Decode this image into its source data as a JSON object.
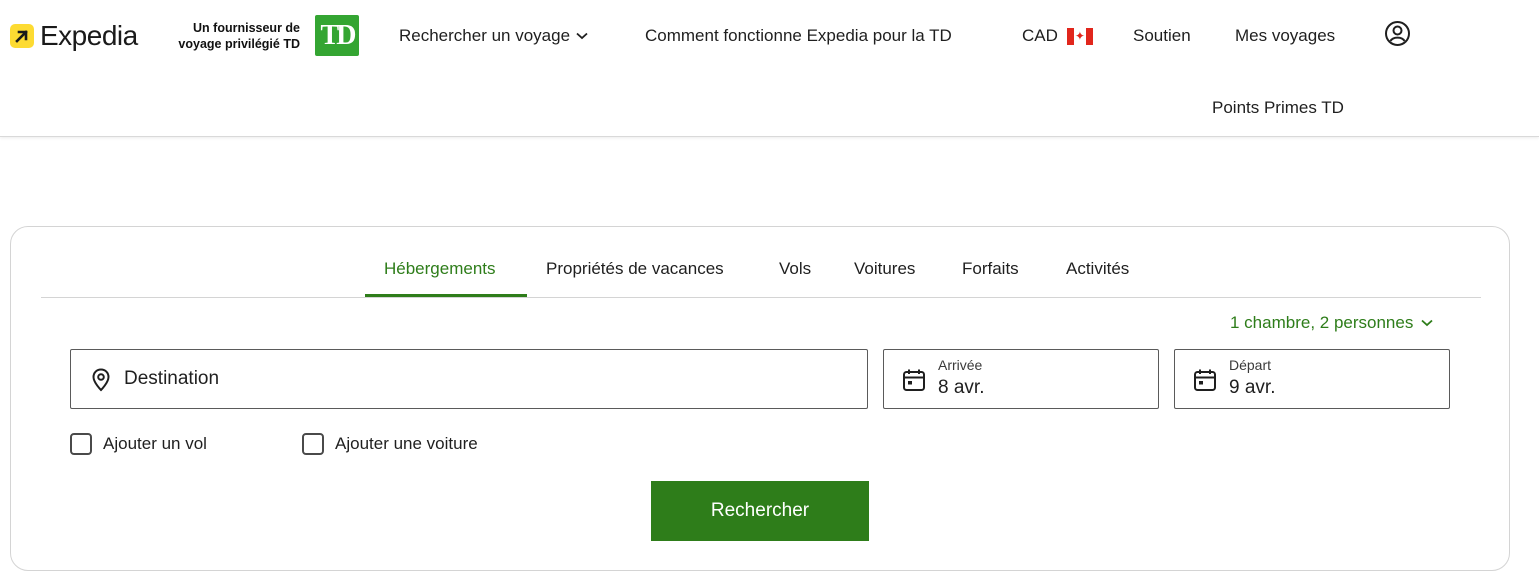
{
  "brand": {
    "name": "Expedia",
    "partner_line1": "Un fournisseur de",
    "partner_line2": "voyage privilégié TD",
    "td_logo_text": "TD",
    "td_logo_color": "#34a532",
    "accent_color": "#2e7d1a",
    "logo_mark_color": "#fddb32"
  },
  "nav": {
    "search_trip": "Rechercher un voyage",
    "how_it_works": "Comment fonctionne Expedia pour la TD",
    "currency": "CAD",
    "support": "Soutien",
    "my_trips": "Mes voyages",
    "points": "Points Primes TD",
    "account_icon": "account-circle-icon",
    "flag_icon": "canada-flag-icon"
  },
  "tabs": [
    {
      "label": "Hébergements",
      "active": true
    },
    {
      "label": "Propriétés de vacances",
      "active": false
    },
    {
      "label": "Vols",
      "active": false
    },
    {
      "label": "Voitures",
      "active": false
    },
    {
      "label": "Forfaits",
      "active": false
    },
    {
      "label": "Activités",
      "active": false
    }
  ],
  "search": {
    "rooms_summary": "1 chambre, 2 personnes",
    "destination_placeholder": "Destination",
    "arrival_label": "Arrivée",
    "arrival_value": "8 avr.",
    "departure_label": "Départ",
    "departure_value": "9 avr.",
    "add_flight": "Ajouter un vol",
    "add_car": "Ajouter une voiture",
    "submit": "Rechercher"
  }
}
